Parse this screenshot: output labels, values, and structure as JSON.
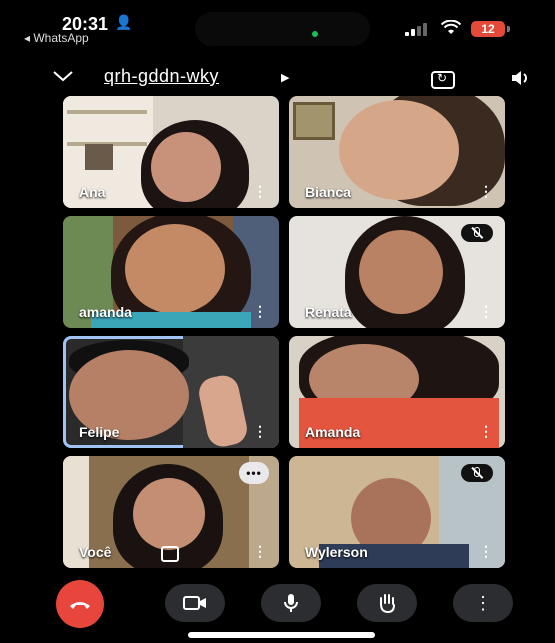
{
  "status_bar": {
    "time": "20:31",
    "back_app": "◂ WhatsApp",
    "battery": "12"
  },
  "meeting": {
    "code": "qrh-gddn-wky"
  },
  "participants": [
    {
      "name": "Ana"
    },
    {
      "name": "Bianca"
    },
    {
      "name": "amanda"
    },
    {
      "name": "Renata"
    },
    {
      "name": "Felipe"
    },
    {
      "name": "Amanda"
    },
    {
      "name": "Você"
    },
    {
      "name": "Wylerson"
    }
  ],
  "icons": {
    "tile_menu": "⋮",
    "chevron": "chevron-down-icon",
    "speaker": "speaker-icon"
  },
  "colors": {
    "end_call": "#e8453c",
    "control_bg": "#2c2d30",
    "active_speaker_border": "#9fc3f2",
    "battery": "#e34a3a"
  }
}
